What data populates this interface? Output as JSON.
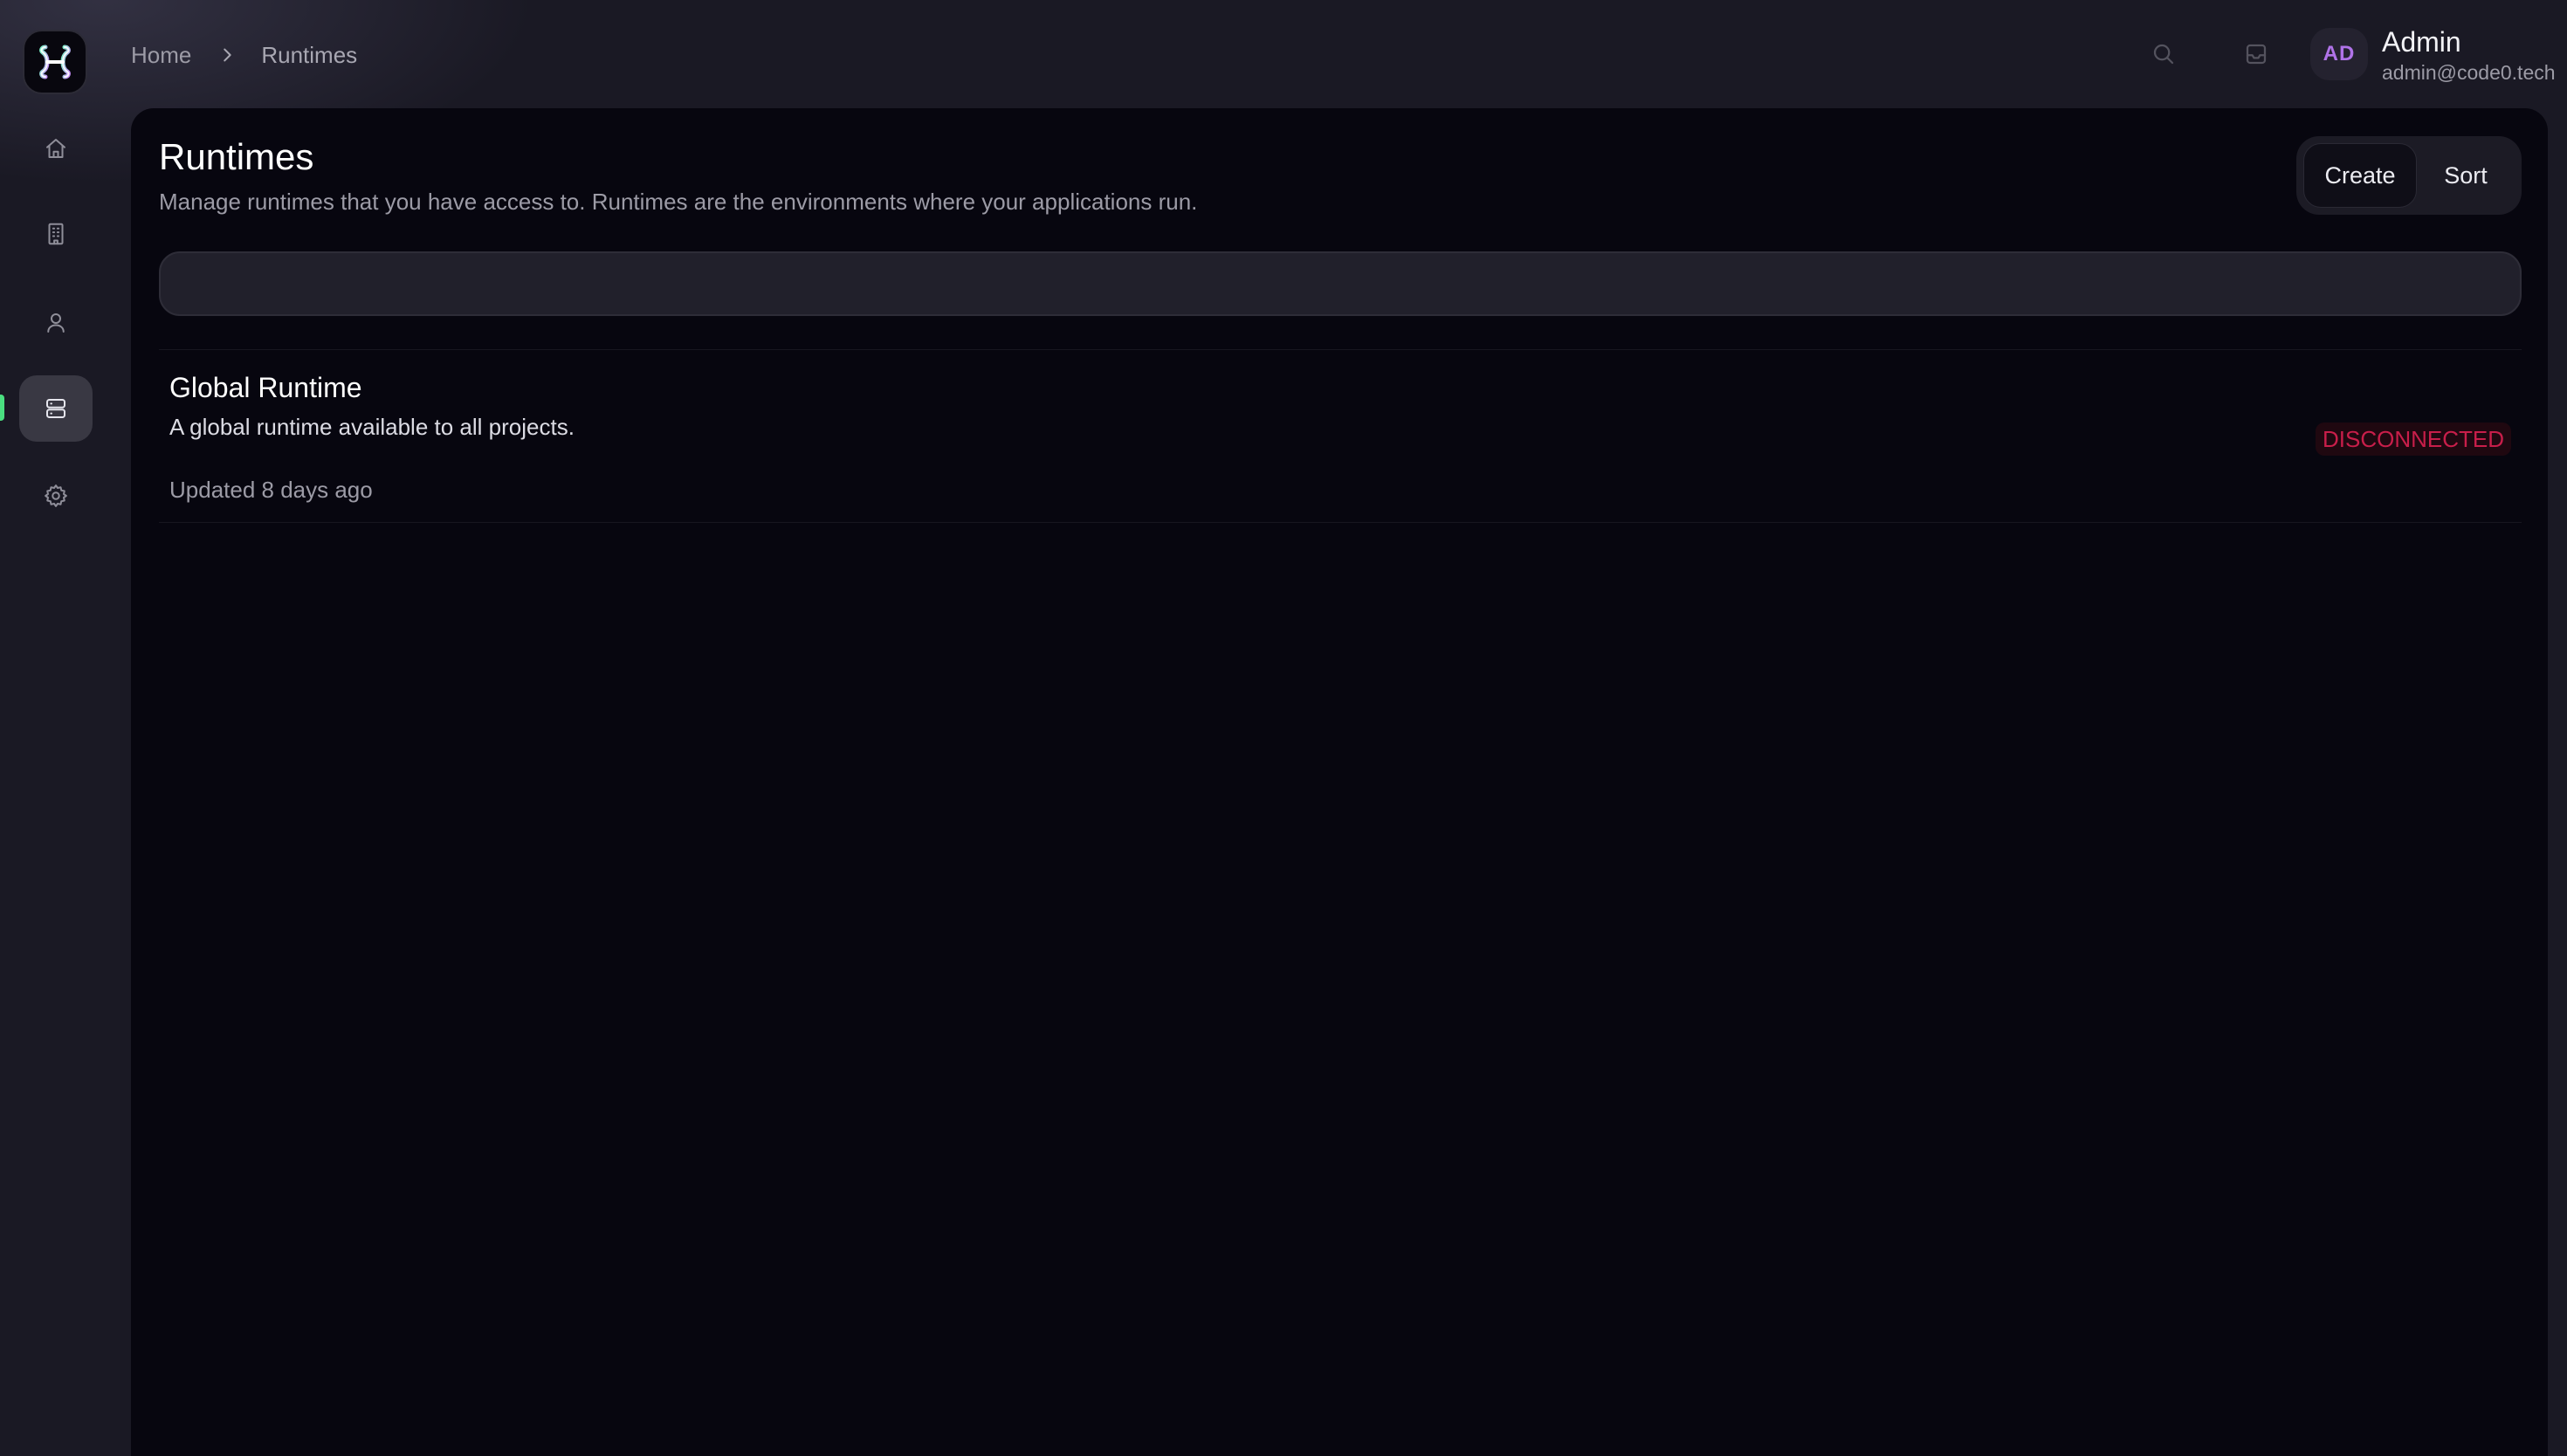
{
  "sidebar": {
    "logo_icon": "code0-logo-icon",
    "items": [
      {
        "name": "home",
        "icon": "home-icon",
        "active": false
      },
      {
        "name": "organizations",
        "icon": "building-icon",
        "active": false
      },
      {
        "name": "users",
        "icon": "user-icon",
        "active": false
      },
      {
        "name": "runtimes",
        "icon": "server-icon",
        "active": true
      },
      {
        "name": "settings",
        "icon": "gear-icon",
        "active": false
      }
    ],
    "active_indicator_color": "#4ade80"
  },
  "breadcrumb": {
    "home": "Home",
    "current": "Runtimes"
  },
  "header": {
    "search_icon": "search-icon",
    "inbox_icon": "inbox-icon",
    "user": {
      "initials": "AD",
      "name": "Admin",
      "email": "admin@code0.tech"
    }
  },
  "page": {
    "title": "Runtimes",
    "description": "Manage runtimes that you have access to. Runtimes are the environments where your applications run.",
    "actions": {
      "create_label": "Create",
      "sort_label": "Sort"
    },
    "search": {
      "value": "",
      "placeholder": ""
    }
  },
  "runtimes": [
    {
      "name": "Global Runtime",
      "description": "A global runtime available to all projects.",
      "updated": "Updated 8 days ago",
      "status": "DISCONNECTED",
      "status_color": "#c81e4a"
    }
  ],
  "colors": {
    "background": "#1a1924",
    "panel": "#07060f",
    "avatar_text": "#b073e8"
  }
}
